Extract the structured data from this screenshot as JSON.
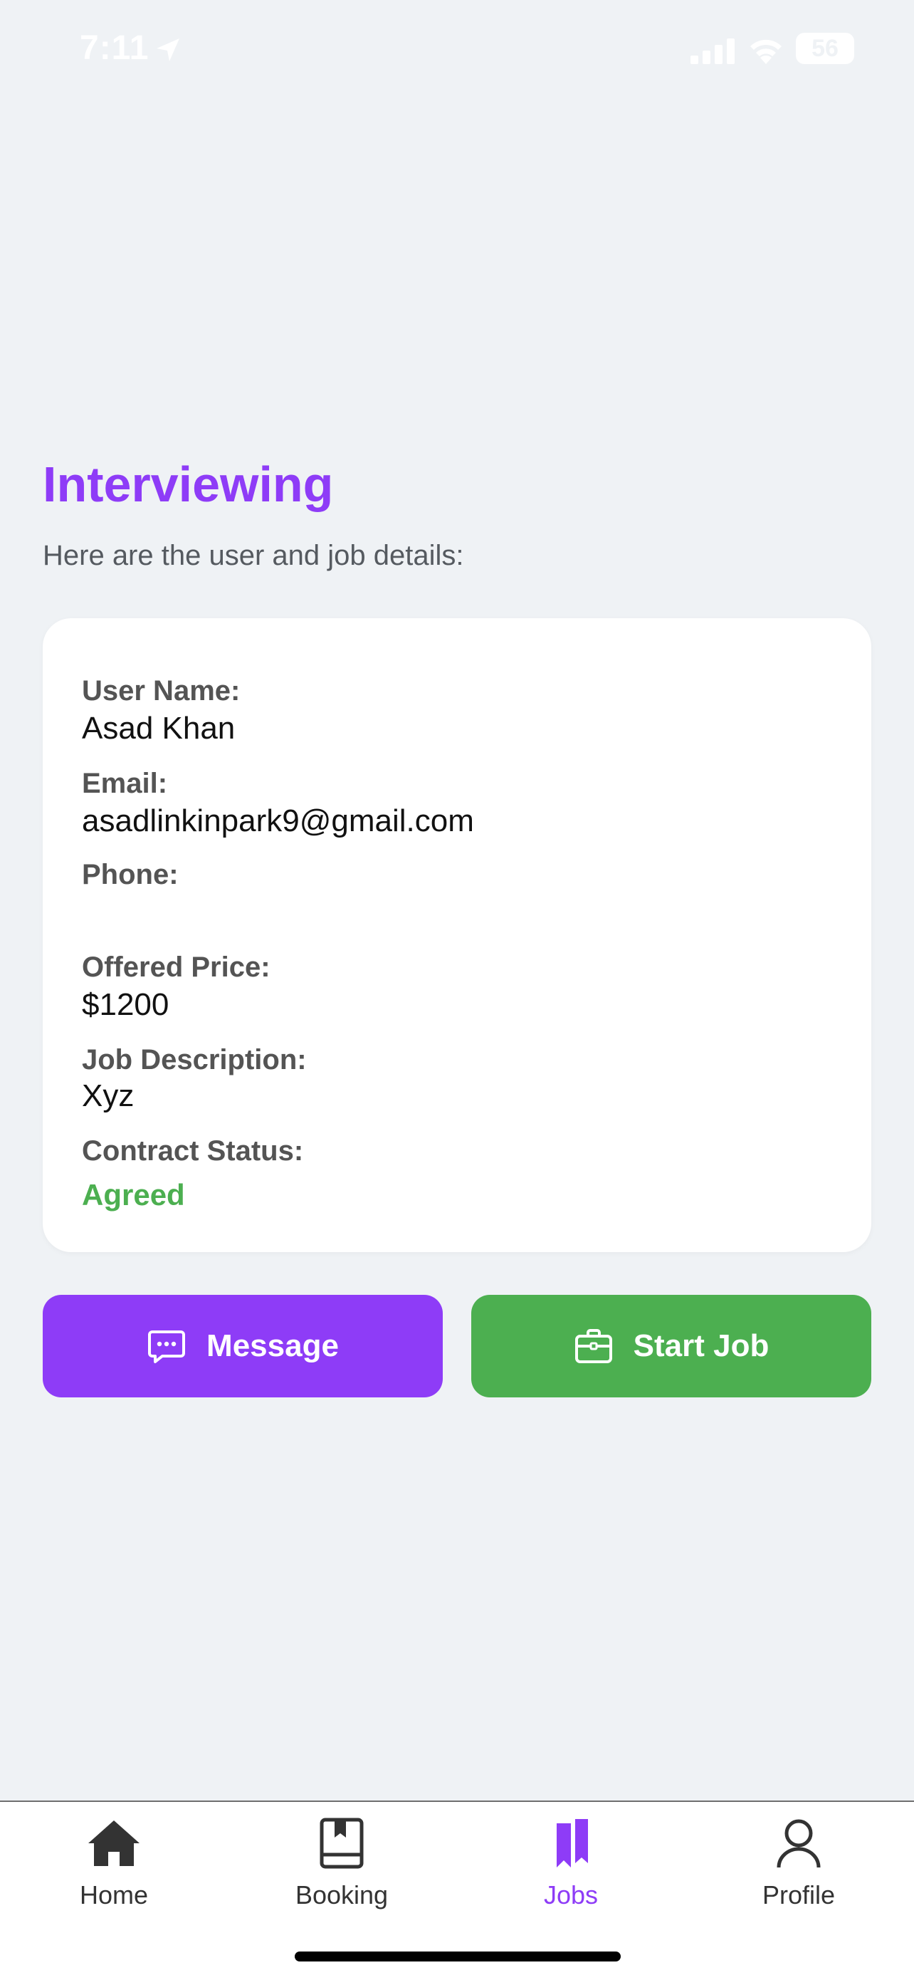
{
  "status_bar": {
    "time": "7:11",
    "battery": "56"
  },
  "header": {
    "title": "Interviewing",
    "subtitle": "Here are the user and job details:"
  },
  "details": {
    "user_name_label": "User Name:",
    "user_name": "Asad Khan",
    "email_label": "Email:",
    "email": "asadlinkinpark9@gmail.com",
    "phone_label": "Phone:",
    "phone": "",
    "offered_price_label": "Offered Price:",
    "offered_price": "$1200",
    "job_description_label": "Job Description:",
    "job_description": "Xyz",
    "contract_status_label": "Contract Status:",
    "contract_status": "Agreed"
  },
  "actions": {
    "message_label": "Message",
    "start_job_label": "Start Job"
  },
  "tabs": [
    {
      "label": "Home",
      "icon": "home-icon"
    },
    {
      "label": "Booking",
      "icon": "book-icon"
    },
    {
      "label": "Jobs",
      "icon": "bookmarks-icon"
    },
    {
      "label": "Profile",
      "icon": "person-icon"
    }
  ],
  "colors": {
    "accent": "#8e3cf7",
    "success": "#4caf50",
    "background": "#eff2f5"
  }
}
